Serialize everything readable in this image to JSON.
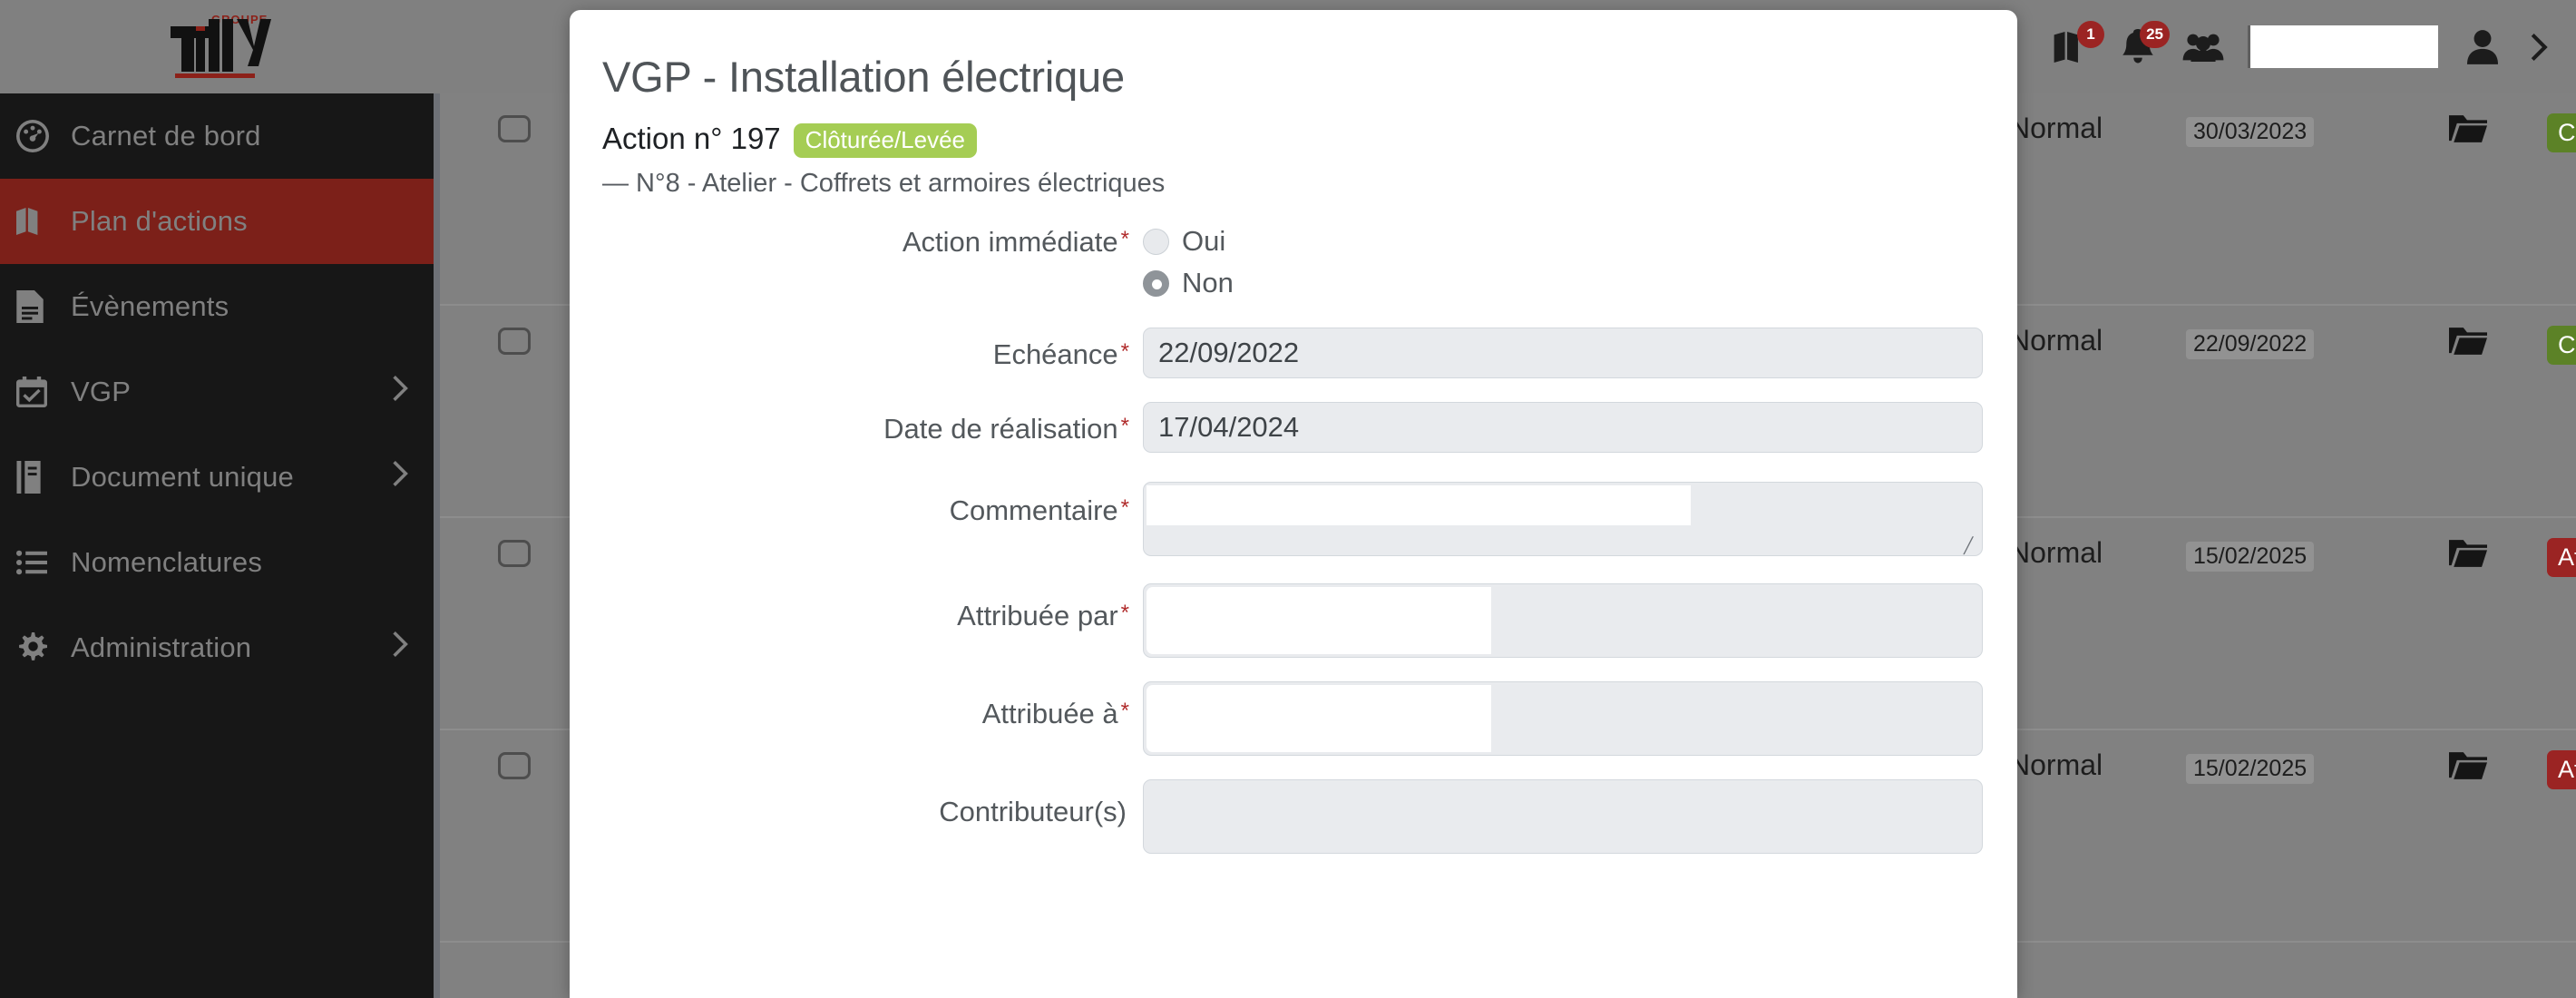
{
  "brand": {
    "name": "TILLY",
    "tagline": "GROUPE",
    "accent": "#8c2119"
  },
  "topbar": {
    "map_badge": "1",
    "bell_badge": "25",
    "icons": [
      "map-icon",
      "bell-icon",
      "users-icon",
      "user-icon",
      "chevron-right-icon"
    ],
    "search_value": ""
  },
  "sidebar": {
    "items": [
      {
        "label": "Carnet de bord",
        "icon": "dashboard-icon",
        "active": false,
        "chevron": false
      },
      {
        "label": "Plan d'actions",
        "icon": "map-icon",
        "active": true,
        "chevron": false
      },
      {
        "label": "Évènements",
        "icon": "document-icon",
        "active": false,
        "chevron": false
      },
      {
        "label": "VGP",
        "icon": "calendar-check-icon",
        "active": false,
        "chevron": true
      },
      {
        "label": "Document unique",
        "icon": "book-icon",
        "active": false,
        "chevron": true
      },
      {
        "label": "Nomenclatures",
        "icon": "list-icon",
        "active": false,
        "chevron": false
      },
      {
        "label": "Administration",
        "icon": "gear-icon",
        "active": false,
        "chevron": true
      }
    ]
  },
  "table": {
    "rows": [
      {
        "priority": "Normal",
        "date": "30/03/2023",
        "status": "Clô",
        "status_color": "#5c8227"
      },
      {
        "priority": "Normal",
        "date": "22/09/2022",
        "status": "Clô",
        "status_color": "#5c8227"
      },
      {
        "priority": "Normal",
        "date": "15/02/2025",
        "status": "Att",
        "status_color": "#9b2423"
      },
      {
        "priority": "Normal",
        "date": "15/02/2025",
        "status": "Att",
        "status_color": "#9b2423"
      }
    ]
  },
  "modal": {
    "title": "VGP - Installation électrique",
    "action_label": "Action n° 197",
    "status_pill": "Clôturée/Levée",
    "status_pill_color": "#a5cd54",
    "path": "— N°8 - Atelier - Coffrets et armoires électriques",
    "fields": {
      "action_immediate": {
        "label": "Action immédiate",
        "required": "*",
        "options": [
          {
            "label": "Oui",
            "selected": false
          },
          {
            "label": "Non",
            "selected": true
          }
        ]
      },
      "echeance": {
        "label": "Echéance",
        "required": "*",
        "value": "22/09/2022"
      },
      "date_realisation": {
        "label": "Date de réalisation",
        "required": "*",
        "value": "17/04/2024"
      },
      "commentaire": {
        "label": "Commentaire",
        "required": "*",
        "value": ""
      },
      "attribuee_par": {
        "label": "Attribuée par",
        "required": "*",
        "value": ""
      },
      "attribuee_a": {
        "label": "Attribuée à",
        "required": "*",
        "value": ""
      },
      "contributeurs": {
        "label": "Contributeur(s)",
        "required": "",
        "value": ""
      }
    }
  }
}
